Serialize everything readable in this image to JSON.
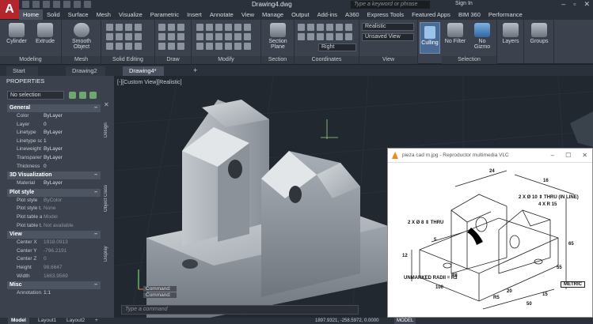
{
  "titlebar": {
    "doc_title": "Drawing4.dwg",
    "search_placeholder": "Type a keyword or phrase",
    "signin": "Sign In"
  },
  "ribbon_tabs": [
    "Home",
    "Solid",
    "Surface",
    "Mesh",
    "Visualize",
    "Parametric",
    "Insert",
    "Annotate",
    "View",
    "Manage",
    "Output",
    "Add-ins",
    "A360",
    "Express Tools",
    "Featured Apps",
    "BIM 360",
    "Performance"
  ],
  "ribbon": {
    "buttons": {
      "cylinder": "Cylinder",
      "extrude": "Extrude",
      "smooth_object": "Smooth Object",
      "section_plane": "Section Plane",
      "culling": "Culling",
      "no_filter": "No Filter",
      "no_gizmo": "No Gizmo",
      "layers": "Layers",
      "groups": "Groups"
    },
    "groups": {
      "modeling": "Modeling",
      "mesh": "Mesh",
      "solid_editing": "Solid Editing",
      "draw": "Draw",
      "modify": "Modify",
      "section": "Section",
      "coordinates": "Coordinates",
      "view": "View",
      "selection": "Selection"
    },
    "dropdowns": {
      "visual_style": "Realistic",
      "saved_view": "Unsaved View",
      "ucs": "Right"
    }
  },
  "file_tabs": [
    "Start",
    "Drawing2",
    "Drawing4*"
  ],
  "properties": {
    "title": "PROPERTIES",
    "selection": "No selection",
    "sections": [
      {
        "name": "General",
        "rows": [
          [
            "Color",
            "ByLayer"
          ],
          [
            "Layer",
            "0"
          ],
          [
            "Linetype",
            "ByLayer"
          ],
          [
            "Linetype sc...",
            "1"
          ],
          [
            "Lineweight",
            "ByLayer"
          ],
          [
            "Transparency",
            "ByLayer"
          ],
          [
            "Thickness",
            "0"
          ]
        ]
      },
      {
        "name": "3D Visualization",
        "rows": [
          [
            "Material",
            "ByLayer"
          ]
        ]
      },
      {
        "name": "Plot style",
        "rows": [
          [
            "Plot style",
            "ByColor"
          ],
          [
            "Plot style t...",
            "None"
          ],
          [
            "Plot table a...",
            "Model"
          ],
          [
            "Plot table t...",
            "Not available"
          ]
        ]
      },
      {
        "name": "View",
        "rows": [
          [
            "Center X",
            "1918.0913"
          ],
          [
            "Center Y",
            "-796.2191"
          ],
          [
            "Center Z",
            "0"
          ],
          [
            "Height",
            "98.6647"
          ],
          [
            "Width",
            "1663.9569"
          ]
        ]
      },
      {
        "name": "Misc",
        "rows": [
          [
            "Annotation...",
            "1:1"
          ]
        ]
      }
    ],
    "side_tabs": [
      "Design",
      "Object Class",
      "Display"
    ]
  },
  "viewport": {
    "label": "[-][Custom View][Realistic]",
    "cmd_history": [
      "Command:",
      "Command:"
    ],
    "cmd_placeholder": "Type a command"
  },
  "vlc": {
    "title": "pieza cad m.jpg - Reproductor multimedia VLC",
    "labels": {
      "thru1": "2 X Ø 10 ⇕ THRU (IN LINE)",
      "r4": "4 X R 15",
      "thru2": "2 X Ø 8 ⇕ THRU",
      "radii": "UNMARKED RADII = R3",
      "metric": "METRIC",
      "d24": "24",
      "d16": "16",
      "d65": "65",
      "d55": "55",
      "d50": "50",
      "d100": "100",
      "d15": "15",
      "d12": "12",
      "d20": "20",
      "d5": "5",
      "r8": "R8",
      "r5": "R5"
    }
  },
  "statusbar": {
    "tabs": [
      "Model",
      "Layout1",
      "Layout2"
    ],
    "coords": "1897.9321, -258.5972, 0.0000",
    "model": "MODEL"
  }
}
